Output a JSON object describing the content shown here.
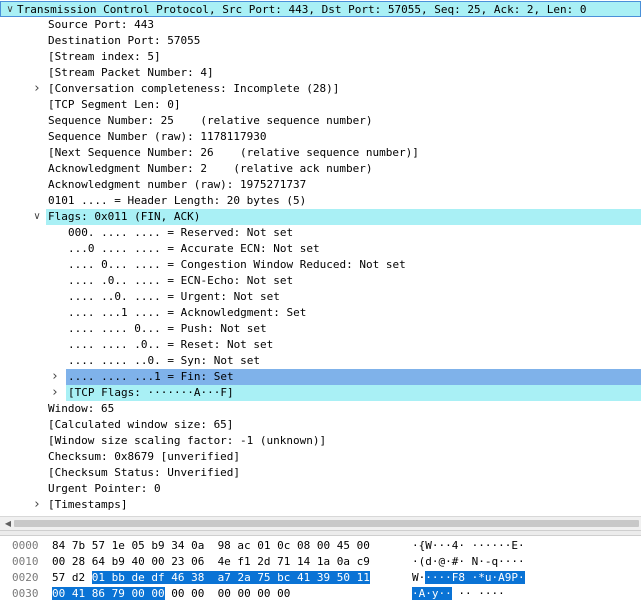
{
  "tree": [
    {
      "indent": 0,
      "arrow": "down",
      "text": "Transmission Control Protocol, Src Port: 443, Dst Port: 57055, Seq: 25, Ack: 2, Len: 0",
      "hl": "top"
    },
    {
      "indent": 1,
      "arrow": "",
      "text": "Source Port: 443",
      "hl": ""
    },
    {
      "indent": 1,
      "arrow": "",
      "text": "Destination Port: 57055",
      "hl": ""
    },
    {
      "indent": 1,
      "arrow": "",
      "text": "[Stream index: 5]",
      "hl": ""
    },
    {
      "indent": 1,
      "arrow": "",
      "text": "[Stream Packet Number: 4]",
      "hl": ""
    },
    {
      "indent": 1,
      "arrow": "right",
      "text": "[Conversation completeness: Incomplete (28)]",
      "hl": ""
    },
    {
      "indent": 1,
      "arrow": "",
      "text": "[TCP Segment Len: 0]",
      "hl": ""
    },
    {
      "indent": 1,
      "arrow": "",
      "text": "Sequence Number: 25    (relative sequence number)",
      "hl": ""
    },
    {
      "indent": 1,
      "arrow": "",
      "text": "Sequence Number (raw): 1178117930",
      "hl": ""
    },
    {
      "indent": 1,
      "arrow": "",
      "text": "[Next Sequence Number: 26    (relative sequence number)]",
      "hl": ""
    },
    {
      "indent": 1,
      "arrow": "",
      "text": "Acknowledgment Number: 2    (relative ack number)",
      "hl": ""
    },
    {
      "indent": 1,
      "arrow": "",
      "text": "Acknowledgment number (raw): 1975271737",
      "hl": ""
    },
    {
      "indent": 1,
      "arrow": "",
      "text": "0101 .... = Header Length: 20 bytes (5)",
      "hl": ""
    },
    {
      "indent": 1,
      "arrow": "down",
      "text": "Flags: 0x011 (FIN, ACK)",
      "hl": "cyan"
    },
    {
      "indent": 2,
      "arrow": "",
      "text": "000. .... .... = Reserved: Not set",
      "hl": ""
    },
    {
      "indent": 2,
      "arrow": "",
      "text": "...0 .... .... = Accurate ECN: Not set",
      "hl": ""
    },
    {
      "indent": 2,
      "arrow": "",
      "text": ".... 0... .... = Congestion Window Reduced: Not set",
      "hl": ""
    },
    {
      "indent": 2,
      "arrow": "",
      "text": ".... .0.. .... = ECN-Echo: Not set",
      "hl": ""
    },
    {
      "indent": 2,
      "arrow": "",
      "text": ".... ..0. .... = Urgent: Not set",
      "hl": ""
    },
    {
      "indent": 2,
      "arrow": "",
      "text": ".... ...1 .... = Acknowledgment: Set",
      "hl": ""
    },
    {
      "indent": 2,
      "arrow": "",
      "text": ".... .... 0... = Push: Not set",
      "hl": ""
    },
    {
      "indent": 2,
      "arrow": "",
      "text": ".... .... .0.. = Reset: Not set",
      "hl": ""
    },
    {
      "indent": 2,
      "arrow": "",
      "text": ".... .... ..0. = Syn: Not set",
      "hl": ""
    },
    {
      "indent": 2,
      "arrow": "right",
      "text": ".... .... ...1 = Fin: Set",
      "hl": "blue"
    },
    {
      "indent": 2,
      "arrow": "right",
      "text": "[TCP Flags: ·······A···F]",
      "hl": "cyan"
    },
    {
      "indent": 1,
      "arrow": "",
      "text": "Window: 65",
      "hl": ""
    },
    {
      "indent": 1,
      "arrow": "",
      "text": "[Calculated window size: 65]",
      "hl": ""
    },
    {
      "indent": 1,
      "arrow": "",
      "text": "[Window size scaling factor: -1 (unknown)]",
      "hl": ""
    },
    {
      "indent": 1,
      "arrow": "",
      "text": "Checksum: 0x8679 [unverified]",
      "hl": ""
    },
    {
      "indent": 1,
      "arrow": "",
      "text": "[Checksum Status: Unverified]",
      "hl": ""
    },
    {
      "indent": 1,
      "arrow": "",
      "text": "Urgent Pointer: 0",
      "hl": ""
    },
    {
      "indent": 1,
      "arrow": "right",
      "text": "[Timestamps]",
      "hl": ""
    }
  ],
  "hex": [
    {
      "offset": "0000",
      "bytes": "84 7b 57 1e 05 b9 34 0a  98 ac 01 0c 08 00 45 00",
      "bytes_sel": "",
      "bytes_post": "",
      "ascii": "·{W···4· ······E·",
      "ascii_sel": "",
      "ascii_post": ""
    },
    {
      "offset": "0010",
      "bytes": "00 28 64 b9 40 00 23 06  4e f1 2d 71 14 1a 0a c9",
      "bytes_sel": "",
      "bytes_post": "",
      "ascii": "·(d·@·#· N·-q····",
      "ascii_sel": "",
      "ascii_post": ""
    },
    {
      "offset": "0020",
      "bytes": "57 d2 ",
      "bytes_sel": "01 bb de df 46 38  a7 2a 75 bc 41 39 50 11",
      "bytes_post": "",
      "ascii": "W·",
      "ascii_sel": "····F8 ·*u·A9P·",
      "ascii_post": ""
    },
    {
      "offset": "0030",
      "bytes": "",
      "bytes_sel": "00 41 86 79 00 00",
      "bytes_post": " 00 00  00 00 00 00",
      "ascii": "",
      "ascii_sel": "·A·y··",
      "ascii_post": " ·· ····"
    }
  ]
}
